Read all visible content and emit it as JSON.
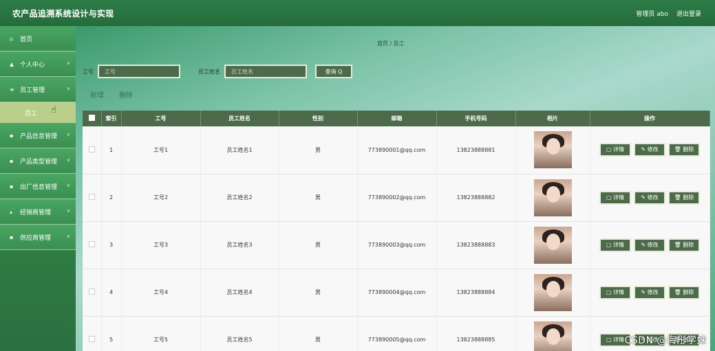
{
  "app": {
    "title": "农产品追溯系统设计与实现"
  },
  "header": {
    "user_label": "管理员 abo",
    "logout_label": "退出登录"
  },
  "sidebar": {
    "items": [
      {
        "label": "首页",
        "icon": "home-icon",
        "has_arrow": false
      },
      {
        "label": "个人中心",
        "icon": "person-icon",
        "has_arrow": true
      },
      {
        "label": "员工管理",
        "icon": "list-icon",
        "has_arrow": true
      },
      {
        "label": "产品信息管理",
        "icon": "grid-icon",
        "has_arrow": true
      },
      {
        "label": "产品类型管理",
        "icon": "grid-icon",
        "has_arrow": true
      },
      {
        "label": "出厂信息管理",
        "icon": "grid-icon",
        "has_arrow": true
      },
      {
        "label": "经销商管理",
        "icon": "bar-icon",
        "has_arrow": true
      },
      {
        "label": "供应商管理",
        "icon": "grid-icon",
        "has_arrow": true
      }
    ],
    "sub_item": "员工"
  },
  "breadcrumb": "首页 / 员工",
  "search": {
    "id_label": "工号",
    "id_placeholder": "工号",
    "name_label": "员工姓名",
    "name_placeholder": "员工姓名",
    "button_label": "查询 Q"
  },
  "actions": {
    "add": "新增",
    "delete": "删除"
  },
  "table": {
    "headers": [
      "索引",
      "工号",
      "员工姓名",
      "性别",
      "邮箱",
      "手机号码",
      "相片",
      "操作"
    ],
    "rows": [
      {
        "index": "1",
        "id": "工号1",
        "name": "员工姓名1",
        "gender": "男",
        "email": "773890001@qq.com",
        "phone": "13823888881"
      },
      {
        "index": "2",
        "id": "工号2",
        "name": "员工姓名2",
        "gender": "男",
        "email": "773890002@qq.com",
        "phone": "13823888882"
      },
      {
        "index": "3",
        "id": "工号3",
        "name": "员工姓名3",
        "gender": "男",
        "email": "773890003@qq.com",
        "phone": "13823888883"
      },
      {
        "index": "4",
        "id": "工号4",
        "name": "员工姓名4",
        "gender": "男",
        "email": "773890004@qq.com",
        "phone": "13823888884"
      },
      {
        "index": "5",
        "id": "工号5",
        "name": "员工姓名5",
        "gender": "男",
        "email": "773890005@qq.com",
        "phone": "13823888885"
      }
    ],
    "op_detail": "详情",
    "op_edit": "修改",
    "op_delete": "删除"
  },
  "watermark": "CSDN @海彤学妹",
  "colors": {
    "header_green": "#2e7d47",
    "button_green": "#4d6b4b",
    "sidebar_green": "#3d9a55"
  }
}
